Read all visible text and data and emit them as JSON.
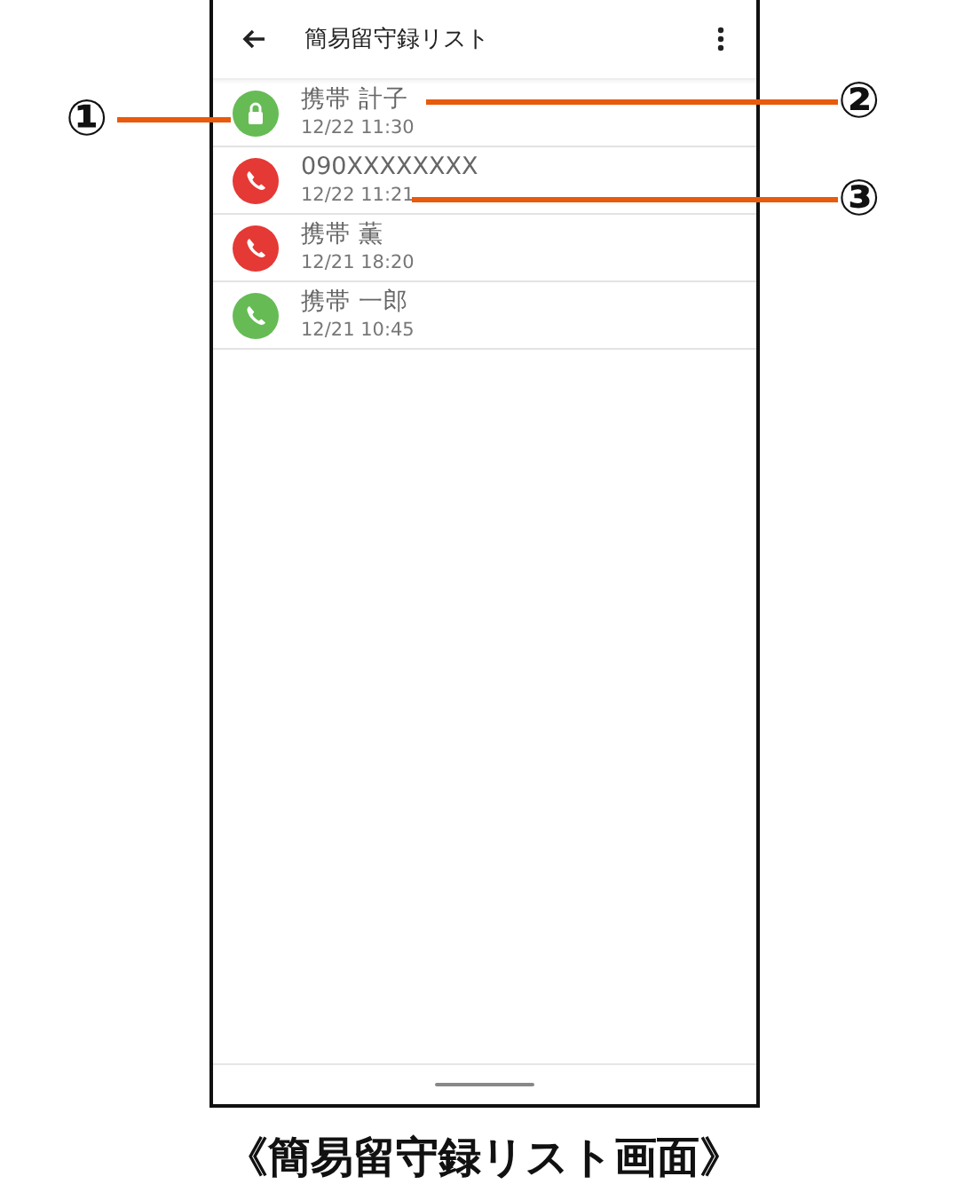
{
  "header": {
    "title": "簡易留守録リスト"
  },
  "messages": [
    {
      "kind": "protected",
      "color": "#66bb55",
      "name": "携帯 計子",
      "time": "12/22 11:30"
    },
    {
      "kind": "call",
      "color": "#e53935",
      "name": "090XXXXXXXX",
      "time": "12/22 11:21"
    },
    {
      "kind": "call",
      "color": "#e53935",
      "name": "携帯 薫",
      "time": "12/21 18:20"
    },
    {
      "kind": "call",
      "color": "#66bb55",
      "name": "携帯 一郎",
      "time": "12/21 10:45"
    }
  ],
  "callouts": [
    "①",
    "②",
    "③"
  ],
  "caption": "《簡易留守録リスト画面》"
}
